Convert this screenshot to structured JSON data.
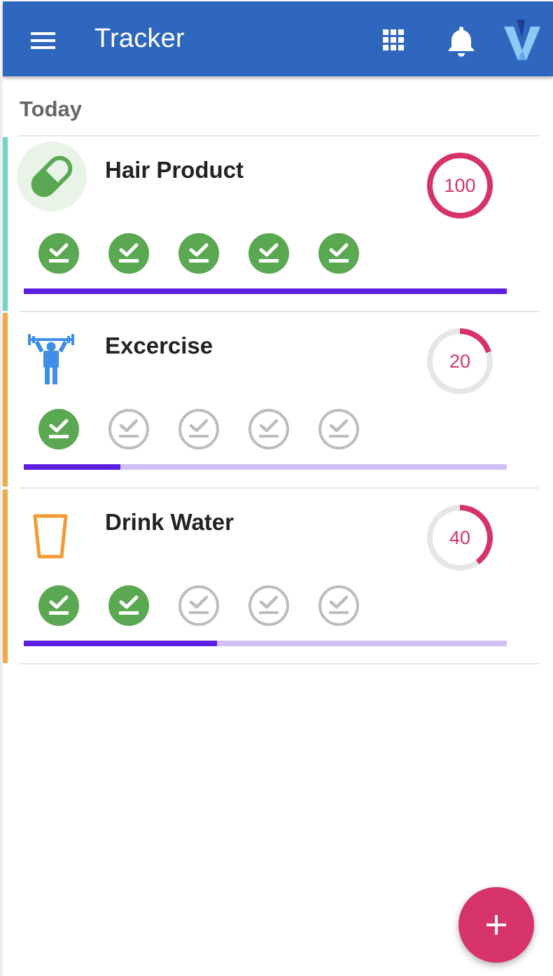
{
  "app_bar": {
    "title": "Tracker",
    "menu_icon": "hamburger-menu-icon",
    "apps_icon": "apps-grid-icon",
    "notifications_icon": "bell-icon",
    "logo_icon": "v-logo-icon"
  },
  "section": {
    "title": "Today"
  },
  "habits": [
    {
      "name": "Hair Product",
      "icon": "pill-icon",
      "accent_color": "#6fd3c8",
      "percent": "100",
      "completed": 5,
      "total": 5,
      "progress_fraction": 1.0
    },
    {
      "name": "Excercise",
      "icon": "weightlifter-icon",
      "accent_color": "#f2a944",
      "percent": "20",
      "completed": 1,
      "total": 5,
      "progress_fraction": 0.2
    },
    {
      "name": "Drink Water",
      "icon": "water-glass-icon",
      "accent_color": "#f2a944",
      "percent": "40",
      "completed": 2,
      "total": 5,
      "progress_fraction": 0.4
    }
  ],
  "fab": {
    "icon": "plus-icon"
  },
  "colors": {
    "app_bar": "#2f67bf",
    "check_done": "#5aa852",
    "check_pending": "#bdbdbd",
    "ring_progress": "#d6336c",
    "ring_track": "#e6e6e6",
    "bar_fill": "#5b1fe0",
    "bar_track": "#d0bff3",
    "fab": "#d6336c"
  }
}
